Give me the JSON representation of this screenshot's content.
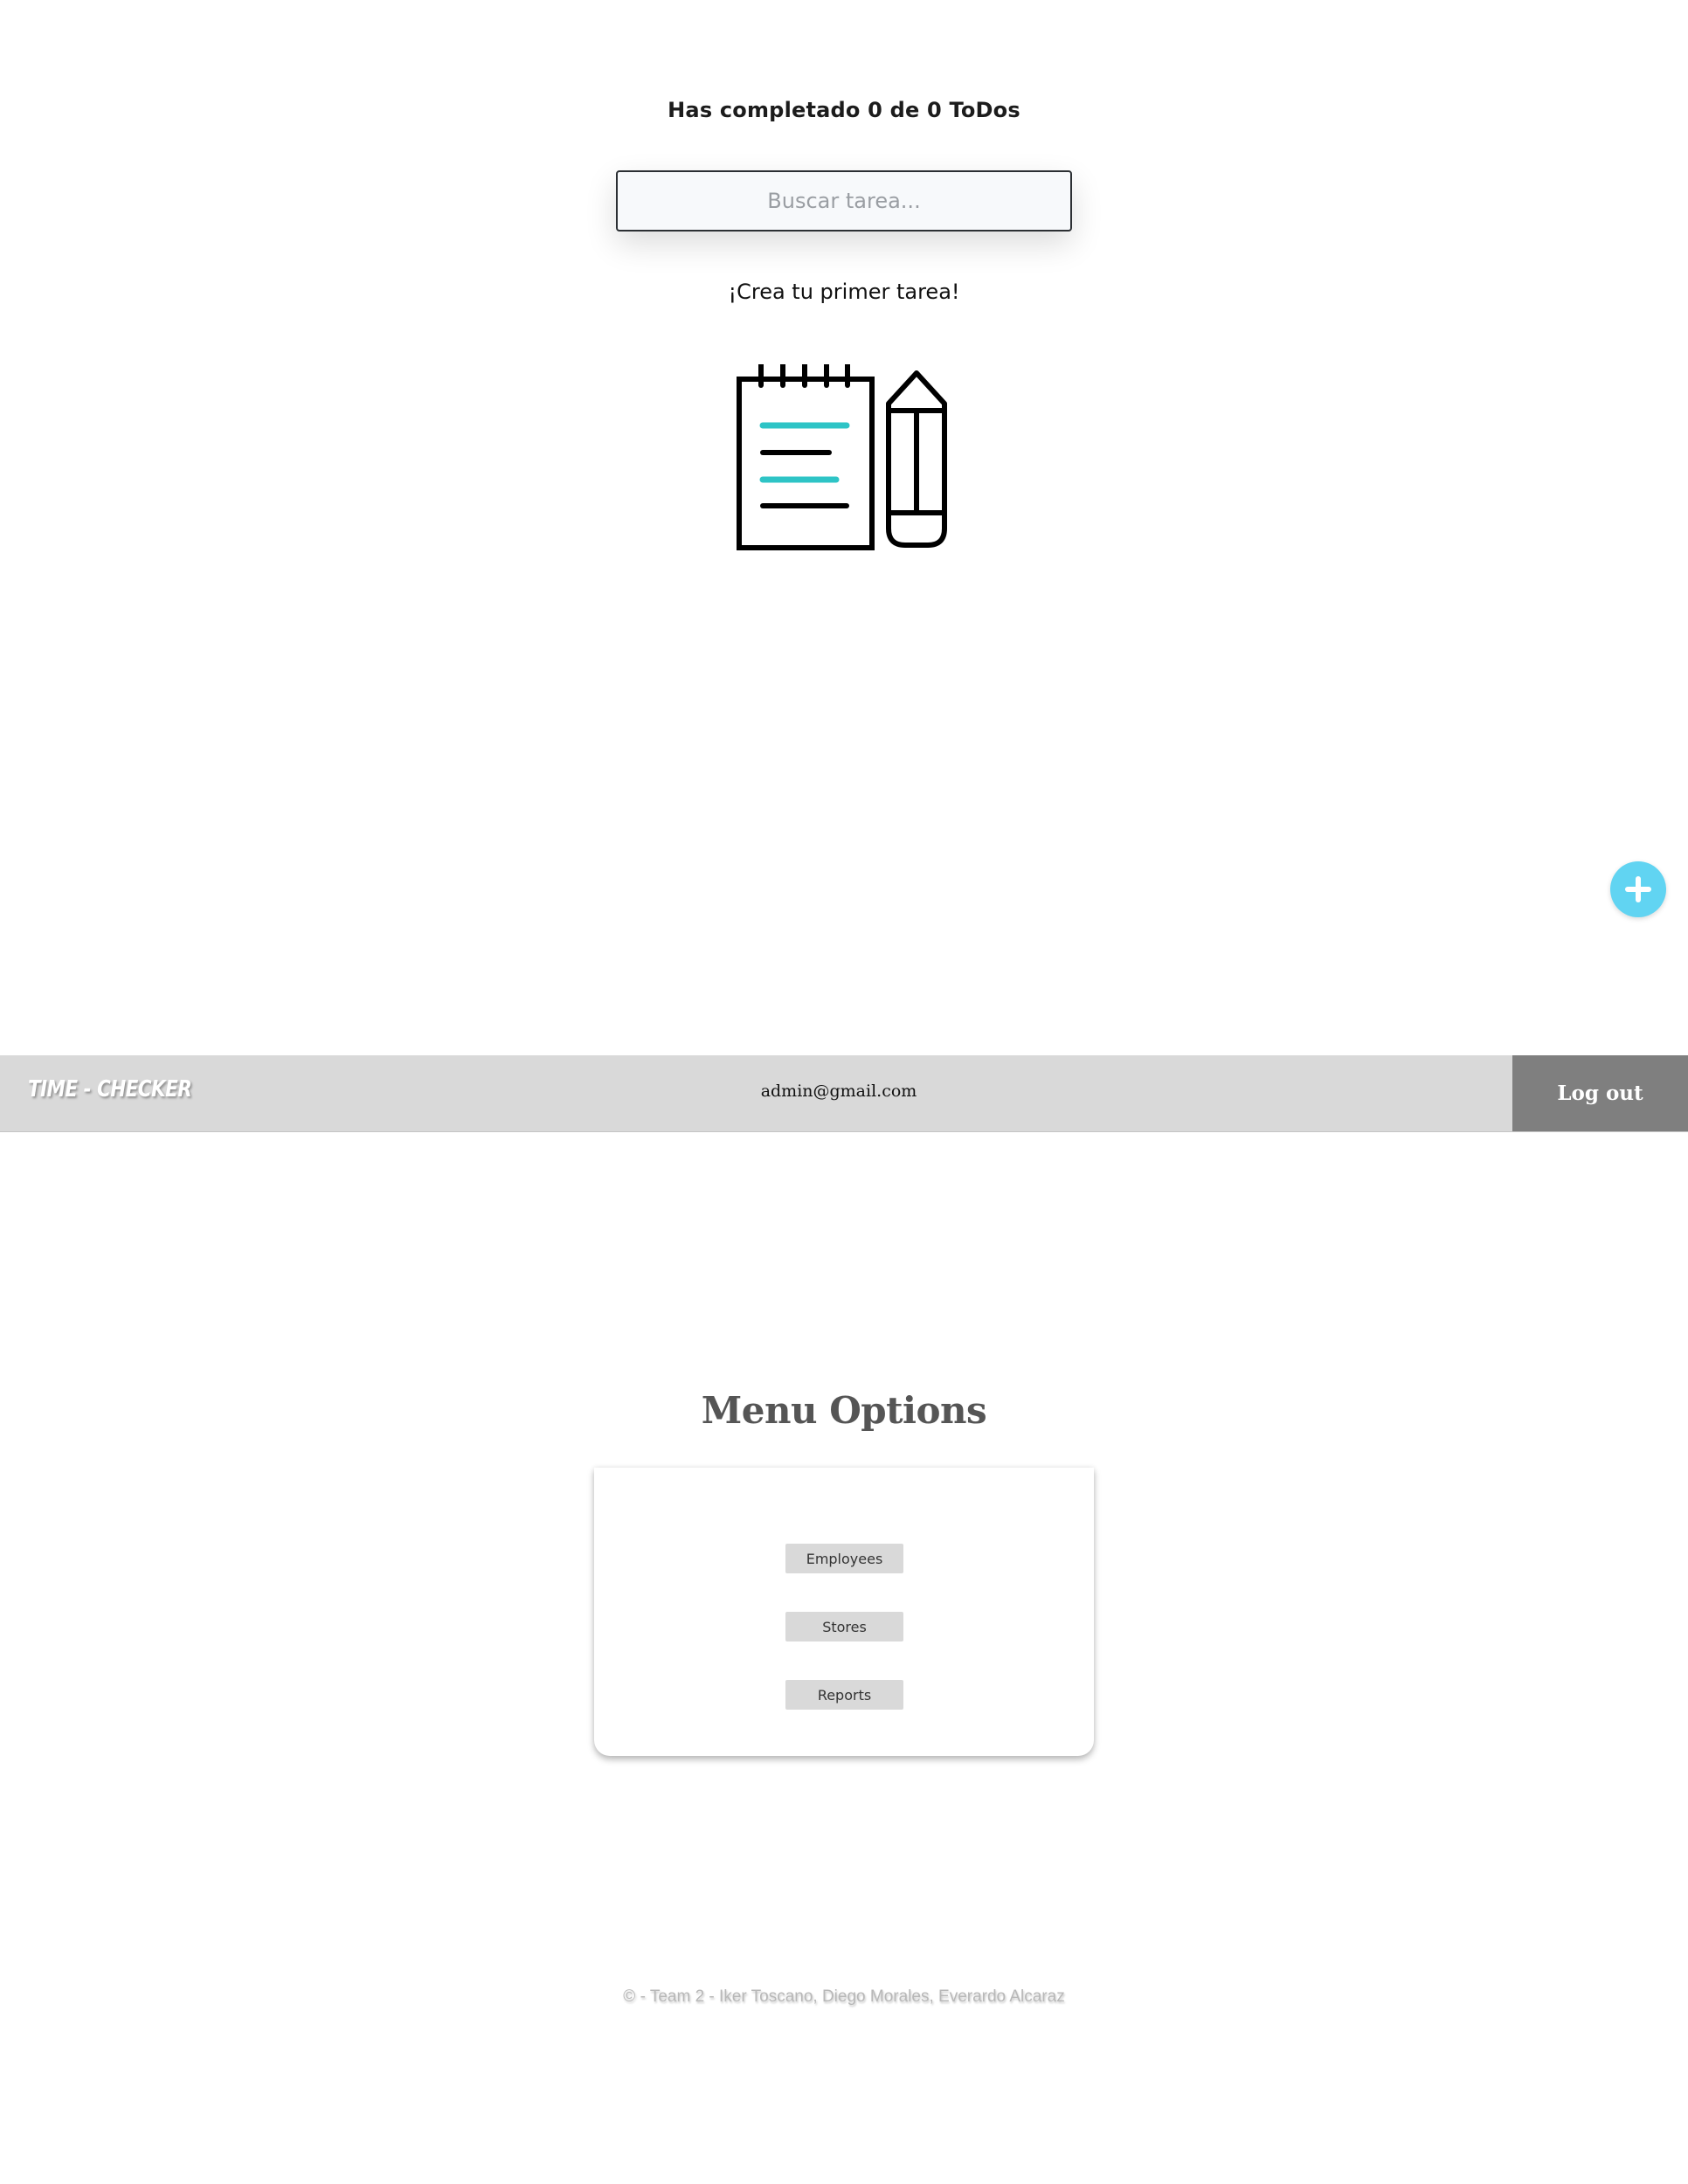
{
  "todo": {
    "counter_text": "Has completado 0 de 0 ToDos",
    "search_placeholder": "Buscar tarea...",
    "empty_message": "¡Crea tu primer tarea!",
    "illustration_icon": "notepad-pencil-icon",
    "add_button_icon": "plus-icon",
    "accent_color": "#61d4f2",
    "illustration_accent_color": "#2ec4c6"
  },
  "navbar": {
    "brand": "TIME - CHECKER",
    "user_email": "admin@gmail.com",
    "logout_label": "Log out"
  },
  "menu": {
    "title": "Menu Options",
    "items": [
      {
        "label": "Employees"
      },
      {
        "label": "Stores"
      },
      {
        "label": "Reports"
      }
    ]
  },
  "footer": {
    "text": "© - Team 2 - Iker Toscano, Diego Morales, Everardo Alcaraz"
  }
}
